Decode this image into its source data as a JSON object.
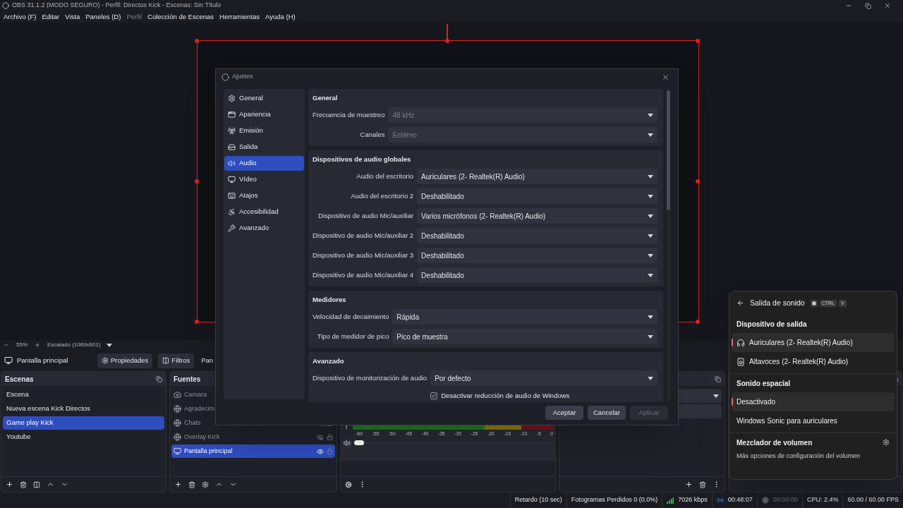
{
  "window": {
    "title": "OBS 31.1.2 (MODO SEGURO) - Perfil: Directos Kick - Escenas: Sin Título"
  },
  "menu": [
    {
      "label": "Archivo (F)",
      "disabled": false
    },
    {
      "label": "Editar",
      "disabled": false
    },
    {
      "label": "Vista",
      "disabled": false
    },
    {
      "label": "Paneles (D)",
      "disabled": false
    },
    {
      "label": "Perfil",
      "disabled": true
    },
    {
      "label": "Colección de Escenas",
      "disabled": false
    },
    {
      "label": "Herramientas",
      "disabled": false
    },
    {
      "label": "Ayuda (H)",
      "disabled": false
    }
  ],
  "preview_bar": {
    "zoom": "55%",
    "scale": "Escalado (1069x601)"
  },
  "source_toolbar": {
    "source": "Pantalla principal",
    "buttons": [
      {
        "label": "Propiedades",
        "kind": "gear"
      },
      {
        "label": "Filtros",
        "kind": "filter"
      }
    ],
    "cut_label": "Pan"
  },
  "scenes": {
    "title": "Escenas",
    "items": [
      {
        "label": "Escena",
        "selected": false
      },
      {
        "label": "Nueva escena Kick Directos",
        "selected": false
      },
      {
        "label": "Game play Kick",
        "selected": true
      },
      {
        "label": "Youtube",
        "selected": false
      }
    ]
  },
  "sources": {
    "title": "Fuentes",
    "items": [
      {
        "label": "Camara",
        "kind": "camera",
        "selected": false,
        "hidden": true
      },
      {
        "label": "Agradecim",
        "kind": "browser",
        "selected": false,
        "hidden": true
      },
      {
        "label": "Chats",
        "kind": "browser",
        "selected": false,
        "hidden": true
      },
      {
        "label": "Overlay Kick",
        "kind": "browser",
        "selected": false,
        "hidden": true
      },
      {
        "label": "Pantalla principal",
        "kind": "display",
        "selected": true,
        "hidden": false
      }
    ]
  },
  "mixer": {
    "ticks": [
      "-60",
      "-55",
      "-50",
      "-45",
      "-40",
      "-35",
      "-30",
      "-25",
      "-20",
      "-15",
      "-10",
      "-5",
      "0"
    ],
    "volume": {
      "level": 0
    }
  },
  "settings": {
    "title": "Ajustes",
    "nav": [
      {
        "label": "General",
        "kind": "general",
        "selected": false
      },
      {
        "label": "Apariencia",
        "kind": "appearance",
        "selected": false
      },
      {
        "label": "Emisión",
        "kind": "stream",
        "selected": false
      },
      {
        "label": "Salida",
        "kind": "output",
        "selected": false
      },
      {
        "label": "Audio",
        "kind": "audio",
        "selected": true
      },
      {
        "label": "Vídeo",
        "kind": "video",
        "selected": false
      },
      {
        "label": "Atajos",
        "kind": "hotkeys",
        "selected": false
      },
      {
        "label": "Accesibilidad",
        "kind": "accessibility",
        "selected": false
      },
      {
        "label": "Avanzado",
        "kind": "advanced",
        "selected": false
      }
    ],
    "sections": [
      {
        "title": "General",
        "rows": [
          {
            "kind": "select",
            "label": "Frecuencia de muestreo",
            "value": "48 kHz",
            "disabled": true
          },
          {
            "kind": "select",
            "label": "Canales",
            "value": "Estéreo",
            "disabled": true
          }
        ]
      },
      {
        "title": "Dispositivos de audio globales",
        "rows": [
          {
            "kind": "select",
            "label": "Audio del escritorio",
            "value": "Auriculares (2- Realtek(R) Audio)",
            "disabled": false
          },
          {
            "kind": "select",
            "label": "Audio del escritorio 2",
            "value": "Deshabilitado",
            "disabled": false
          },
          {
            "kind": "select",
            "label": "Dispositivo de audio Mic/auxiliar",
            "value": "Varios micrófonos (2- Realtek(R) Audio)",
            "disabled": false
          },
          {
            "kind": "select",
            "label": "Dispositivo de audio Mic/auxiliar 2",
            "value": "Deshabilitado",
            "disabled": false
          },
          {
            "kind": "select",
            "label": "Dispositivo de audio Mic/auxiliar 3",
            "value": "Deshabilitado",
            "disabled": false
          },
          {
            "kind": "select",
            "label": "Dispositivo de audio Mic/auxiliar 4",
            "value": "Deshabilitado",
            "disabled": false
          }
        ]
      },
      {
        "title": "Medidores",
        "rows": [
          {
            "kind": "select",
            "label": "Velocidad de decaimiento",
            "value": "Rápida",
            "disabled": false
          },
          {
            "kind": "select",
            "label": "Tipo de medidor de pico",
            "value": "Pico de muestra",
            "disabled": false
          }
        ]
      },
      {
        "title": "Avanzado",
        "rows": [
          {
            "kind": "select",
            "label": "Dispositivo de monitorización de audio",
            "value": "Por defecto",
            "disabled": false
          },
          {
            "kind": "checkbox",
            "label": "Desactivar reducción de audio de Windows",
            "checked": true
          }
        ]
      }
    ],
    "buttons": [
      {
        "label": "Aceptar",
        "disabled": false
      },
      {
        "label": "Cancelar",
        "disabled": false
      },
      {
        "label": "Aplicar",
        "disabled": true
      }
    ]
  },
  "sound_flyout": {
    "title": "Salida de sonido",
    "keys": [
      "CTRL",
      "V"
    ],
    "sections": [
      {
        "title": "Dispositivo de salida",
        "items": [
          {
            "label": "Auriculares (2- Realtek(R) Audio)",
            "kind": "headphones",
            "selected": true
          },
          {
            "label": "Altavoces (2- Realtek(R) Audio)",
            "kind": "speaker",
            "selected": false
          }
        ]
      },
      {
        "title": "Sonido espacial",
        "items": [
          {
            "label": "Desactivado",
            "kind": "plain",
            "selected": true
          },
          {
            "label": "Windows Sonic para auriculares",
            "kind": "plain",
            "selected": false
          }
        ]
      }
    ],
    "mixer_title": "Mezclador de volumen",
    "more_link": "Más opciones de configuración del volumen"
  },
  "status_bar": [
    {
      "kind": "text",
      "text": "Retardo (10 sec)"
    },
    {
      "kind": "text",
      "text": "Fotogramas Perdidos 0 (0.0%)"
    },
    {
      "kind": "bitrate",
      "text": "7026 kbps"
    },
    {
      "kind": "stream",
      "text": "00:48:07"
    },
    {
      "kind": "record",
      "text": "00:00:00"
    },
    {
      "kind": "text",
      "text": "CPU: 2.4%"
    },
    {
      "kind": "text",
      "text": "60.00 / 60.00 FPS"
    }
  ]
}
